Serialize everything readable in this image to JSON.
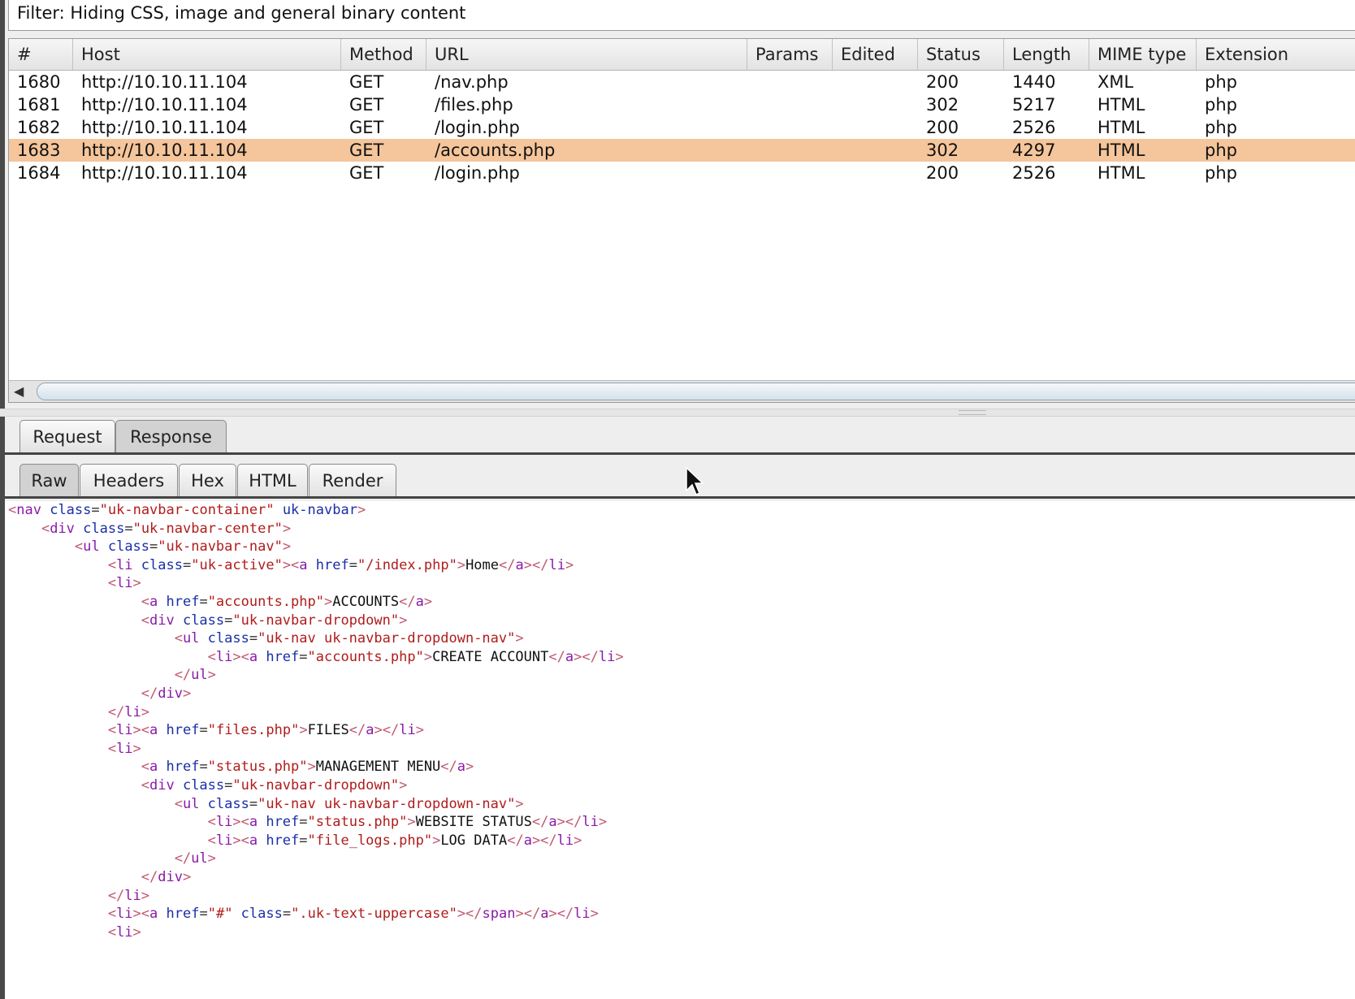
{
  "filter": {
    "text": "Filter: Hiding CSS, image and general binary content"
  },
  "table": {
    "columns": [
      "#",
      "Host",
      "Method",
      "URL",
      "Params",
      "Edited",
      "Status",
      "Length",
      "MIME type",
      "Extension"
    ],
    "rows": [
      {
        "num": "1680",
        "host": "http://10.10.11.104",
        "method": "GET",
        "url": "/nav.php",
        "params": "",
        "edited": "",
        "status": "200",
        "length": "1440",
        "mime": "XML",
        "ext": "php",
        "selected": false
      },
      {
        "num": "1681",
        "host": "http://10.10.11.104",
        "method": "GET",
        "url": "/files.php",
        "params": "",
        "edited": "",
        "status": "302",
        "length": "5217",
        "mime": "HTML",
        "ext": "php",
        "selected": false
      },
      {
        "num": "1682",
        "host": "http://10.10.11.104",
        "method": "GET",
        "url": "/login.php",
        "params": "",
        "edited": "",
        "status": "200",
        "length": "2526",
        "mime": "HTML",
        "ext": "php",
        "selected": false
      },
      {
        "num": "1683",
        "host": "http://10.10.11.104",
        "method": "GET",
        "url": "/accounts.php",
        "params": "",
        "edited": "",
        "status": "302",
        "length": "4297",
        "mime": "HTML",
        "ext": "php",
        "selected": true
      },
      {
        "num": "1684",
        "host": "http://10.10.11.104",
        "method": "GET",
        "url": "/login.php",
        "params": "",
        "edited": "",
        "status": "200",
        "length": "2526",
        "mime": "HTML",
        "ext": "php",
        "selected": false
      }
    ]
  },
  "message_tabs": {
    "request": "Request",
    "response": "Response",
    "active": "Response"
  },
  "view_tabs": {
    "raw": "Raw",
    "headers": "Headers",
    "hex": "Hex",
    "html": "HTML",
    "render": "Render",
    "active": "Raw"
  },
  "code_lines": [
    [
      [
        "<",
        "br"
      ],
      [
        "nav",
        "tag"
      ],
      [
        " class",
        "attr"
      ],
      [
        "=",
        "eq"
      ],
      [
        "\"uk-navbar-container\"",
        "val"
      ],
      [
        " uk-navbar",
        "attr"
      ],
      [
        ">",
        "br"
      ]
    ],
    [
      [
        "    <",
        "br"
      ],
      [
        "div",
        "tag"
      ],
      [
        " class",
        "attr"
      ],
      [
        "=",
        "eq"
      ],
      [
        "\"uk-navbar-center\"",
        "val"
      ],
      [
        ">",
        "br"
      ]
    ],
    [
      [
        "        <",
        "br"
      ],
      [
        "ul",
        "tag"
      ],
      [
        " class",
        "attr"
      ],
      [
        "=",
        "eq"
      ],
      [
        "\"uk-navbar-nav\"",
        "val"
      ],
      [
        ">",
        "br"
      ]
    ],
    [
      [
        "            <",
        "br"
      ],
      [
        "li",
        "tag"
      ],
      [
        " class",
        "attr"
      ],
      [
        "=",
        "eq"
      ],
      [
        "\"uk-active\"",
        "val"
      ],
      [
        "><",
        "br"
      ],
      [
        "a",
        "tag"
      ],
      [
        " href",
        "attr"
      ],
      [
        "=",
        "eq"
      ],
      [
        "\"/index.php\"",
        "val"
      ],
      [
        ">",
        "br"
      ],
      [
        "Home",
        "txt"
      ],
      [
        "</",
        "br"
      ],
      [
        "a",
        "tag"
      ],
      [
        "></",
        "br"
      ],
      [
        "li",
        "tag"
      ],
      [
        ">",
        "br"
      ]
    ],
    [
      [
        "            <",
        "br"
      ],
      [
        "li",
        "tag"
      ],
      [
        ">",
        "br"
      ]
    ],
    [
      [
        "                <",
        "br"
      ],
      [
        "a",
        "tag"
      ],
      [
        " href",
        "attr"
      ],
      [
        "=",
        "eq"
      ],
      [
        "\"accounts.php\"",
        "val"
      ],
      [
        ">",
        "br"
      ],
      [
        "ACCOUNTS",
        "txt"
      ],
      [
        "</",
        "br"
      ],
      [
        "a",
        "tag"
      ],
      [
        ">",
        "br"
      ]
    ],
    [
      [
        "                <",
        "br"
      ],
      [
        "div",
        "tag"
      ],
      [
        " class",
        "attr"
      ],
      [
        "=",
        "eq"
      ],
      [
        "\"uk-navbar-dropdown\"",
        "val"
      ],
      [
        ">",
        "br"
      ]
    ],
    [
      [
        "                    <",
        "br"
      ],
      [
        "ul",
        "tag"
      ],
      [
        " class",
        "attr"
      ],
      [
        "=",
        "eq"
      ],
      [
        "\"uk-nav uk-navbar-dropdown-nav\"",
        "val"
      ],
      [
        ">",
        "br"
      ]
    ],
    [
      [
        "                        <",
        "br"
      ],
      [
        "li",
        "tag"
      ],
      [
        "><",
        "br"
      ],
      [
        "a",
        "tag"
      ],
      [
        " href",
        "attr"
      ],
      [
        "=",
        "eq"
      ],
      [
        "\"accounts.php\"",
        "val"
      ],
      [
        ">",
        "br"
      ],
      [
        "CREATE ACCOUNT",
        "txt"
      ],
      [
        "</",
        "br"
      ],
      [
        "a",
        "tag"
      ],
      [
        "></",
        "br"
      ],
      [
        "li",
        "tag"
      ],
      [
        ">",
        "br"
      ]
    ],
    [
      [
        "                    </",
        "br"
      ],
      [
        "ul",
        "tag"
      ],
      [
        ">",
        "br"
      ]
    ],
    [
      [
        "                </",
        "br"
      ],
      [
        "div",
        "tag"
      ],
      [
        ">",
        "br"
      ]
    ],
    [
      [
        "            </",
        "br"
      ],
      [
        "li",
        "tag"
      ],
      [
        ">",
        "br"
      ]
    ],
    [
      [
        "            <",
        "br"
      ],
      [
        "li",
        "tag"
      ],
      [
        "><",
        "br"
      ],
      [
        "a",
        "tag"
      ],
      [
        " href",
        "attr"
      ],
      [
        "=",
        "eq"
      ],
      [
        "\"files.php\"",
        "val"
      ],
      [
        ">",
        "br"
      ],
      [
        "FILES",
        "txt"
      ],
      [
        "</",
        "br"
      ],
      [
        "a",
        "tag"
      ],
      [
        "></",
        "br"
      ],
      [
        "li",
        "tag"
      ],
      [
        ">",
        "br"
      ]
    ],
    [
      [
        "            <",
        "br"
      ],
      [
        "li",
        "tag"
      ],
      [
        ">",
        "br"
      ]
    ],
    [
      [
        "                <",
        "br"
      ],
      [
        "a",
        "tag"
      ],
      [
        " href",
        "attr"
      ],
      [
        "=",
        "eq"
      ],
      [
        "\"status.php\"",
        "val"
      ],
      [
        ">",
        "br"
      ],
      [
        "MANAGEMENT MENU",
        "txt"
      ],
      [
        "</",
        "br"
      ],
      [
        "a",
        "tag"
      ],
      [
        ">",
        "br"
      ]
    ],
    [
      [
        "                <",
        "br"
      ],
      [
        "div",
        "tag"
      ],
      [
        " class",
        "attr"
      ],
      [
        "=",
        "eq"
      ],
      [
        "\"uk-navbar-dropdown\"",
        "val"
      ],
      [
        ">",
        "br"
      ]
    ],
    [
      [
        "                    <",
        "br"
      ],
      [
        "ul",
        "tag"
      ],
      [
        " class",
        "attr"
      ],
      [
        "=",
        "eq"
      ],
      [
        "\"uk-nav uk-navbar-dropdown-nav\"",
        "val"
      ],
      [
        ">",
        "br"
      ]
    ],
    [
      [
        "                        <",
        "br"
      ],
      [
        "li",
        "tag"
      ],
      [
        "><",
        "br"
      ],
      [
        "a",
        "tag"
      ],
      [
        " href",
        "attr"
      ],
      [
        "=",
        "eq"
      ],
      [
        "\"status.php\"",
        "val"
      ],
      [
        ">",
        "br"
      ],
      [
        "WEBSITE STATUS",
        "txt"
      ],
      [
        "</",
        "br"
      ],
      [
        "a",
        "tag"
      ],
      [
        "></",
        "br"
      ],
      [
        "li",
        "tag"
      ],
      [
        ">",
        "br"
      ]
    ],
    [
      [
        "                        <",
        "br"
      ],
      [
        "li",
        "tag"
      ],
      [
        "><",
        "br"
      ],
      [
        "a",
        "tag"
      ],
      [
        " href",
        "attr"
      ],
      [
        "=",
        "eq"
      ],
      [
        "\"file_logs.php\"",
        "val"
      ],
      [
        ">",
        "br"
      ],
      [
        "LOG DATA",
        "txt"
      ],
      [
        "</",
        "br"
      ],
      [
        "a",
        "tag"
      ],
      [
        "></",
        "br"
      ],
      [
        "li",
        "tag"
      ],
      [
        ">",
        "br"
      ]
    ],
    [
      [
        "                    </",
        "br"
      ],
      [
        "ul",
        "tag"
      ],
      [
        ">",
        "br"
      ]
    ],
    [
      [
        "                </",
        "br"
      ],
      [
        "div",
        "tag"
      ],
      [
        ">",
        "br"
      ]
    ],
    [
      [
        "            </",
        "br"
      ],
      [
        "li",
        "tag"
      ],
      [
        ">",
        "br"
      ]
    ],
    [
      [
        "            <",
        "br"
      ],
      [
        "li",
        "tag"
      ],
      [
        "><",
        "br"
      ],
      [
        "a",
        "tag"
      ],
      [
        " href",
        "attr"
      ],
      [
        "=",
        "eq"
      ],
      [
        "\"#\"",
        "val"
      ],
      [
        " class",
        "attr"
      ],
      [
        "=",
        "eq"
      ],
      [
        "\".uk-text-uppercase\"",
        "val"
      ],
      [
        "></",
        "br"
      ],
      [
        "span",
        "tag"
      ],
      [
        "></",
        "br"
      ],
      [
        "a",
        "tag"
      ],
      [
        "></",
        "br"
      ],
      [
        "li",
        "tag"
      ],
      [
        ">",
        "br"
      ]
    ],
    [
      [
        "            <",
        "br"
      ],
      [
        "li",
        "tag"
      ],
      [
        ">",
        "br"
      ]
    ]
  ],
  "colors": {
    "selected_row": "#f5c59b",
    "bracket": "#c05870",
    "tag": "#8a1aa8",
    "attribute": "#1a2fa8",
    "value": "#b01c1c",
    "text": "#111111"
  },
  "icons": {
    "scroll_left": "triangle-left-icon",
    "cursor": "mouse-pointer-icon"
  }
}
